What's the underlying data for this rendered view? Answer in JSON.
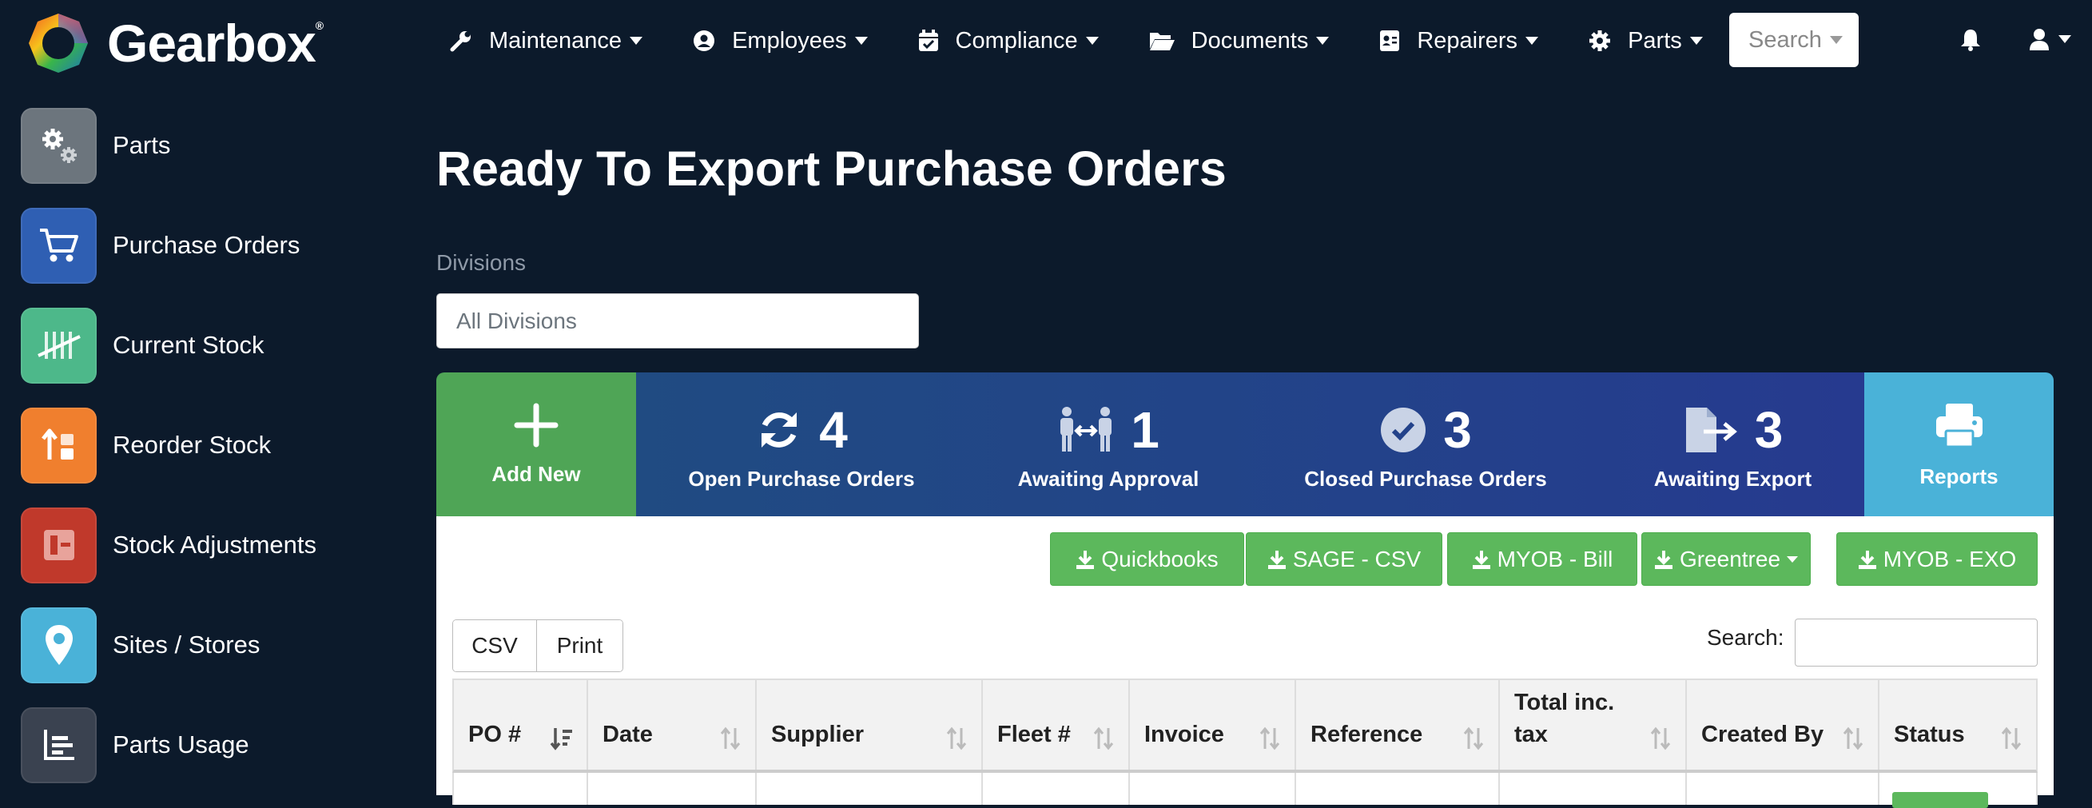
{
  "app": {
    "name": "Gearbox",
    "registered_mark": "®"
  },
  "nav": {
    "items": [
      {
        "label": "Maintenance",
        "icon": "wrench-icon"
      },
      {
        "label": "Employees",
        "icon": "user-circle-icon"
      },
      {
        "label": "Compliance",
        "icon": "calendar-check-icon"
      },
      {
        "label": "Documents",
        "icon": "folder-open-icon"
      },
      {
        "label": "Repairers",
        "icon": "id-card-icon"
      },
      {
        "label": "Parts",
        "icon": "gear-icon"
      }
    ],
    "search_label": "Search"
  },
  "sidebar": {
    "items": [
      {
        "label": "Parts",
        "icon": "gears-icon",
        "color": "#6c757d"
      },
      {
        "label": "Purchase Orders",
        "icon": "shopping-cart-icon",
        "color": "#2f5fb3"
      },
      {
        "label": "Current Stock",
        "icon": "tally-icon",
        "color": "#4db88a"
      },
      {
        "label": "Reorder Stock",
        "icon": "reorder-icon",
        "color": "#f07f2e"
      },
      {
        "label": "Stock Adjustments",
        "icon": "adjust-icon",
        "color": "#c0392b"
      },
      {
        "label": "Sites / Stores",
        "icon": "map-pin-icon",
        "color": "#4ab2d8"
      },
      {
        "label": "Parts Usage",
        "icon": "bar-chart-icon",
        "color": "#3a4250"
      }
    ]
  },
  "page": {
    "title": "Ready To Export Purchase Orders",
    "divisions_label": "Divisions",
    "divisions_placeholder": "All Divisions"
  },
  "stats": {
    "add_new": "Add New",
    "open": {
      "count": "4",
      "label": "Open Purchase Orders"
    },
    "awaiting_approval": {
      "count": "1",
      "label": "Awaiting Approval"
    },
    "closed": {
      "count": "3",
      "label": "Closed Purchase Orders"
    },
    "awaiting_export": {
      "count": "3",
      "label": "Awaiting Export"
    },
    "reports": "Reports"
  },
  "export_buttons": [
    "Quickbooks",
    "SAGE - CSV",
    "MYOB - Bill",
    "Greentree",
    "MYOB - EXO"
  ],
  "table_tools": {
    "csv": "CSV",
    "print": "Print",
    "search_label": "Search:"
  },
  "table": {
    "columns": [
      {
        "label": "PO #"
      },
      {
        "label": "Date"
      },
      {
        "label": "Supplier"
      },
      {
        "label": "Fleet #"
      },
      {
        "label": "Invoice"
      },
      {
        "label": "Reference"
      },
      {
        "label": "Total inc.\ntax"
      },
      {
        "label": "Created By"
      },
      {
        "label": "Status"
      }
    ]
  },
  "colors": {
    "background": "#0c1a2b",
    "add_new": "#4fa556",
    "stats_band": "#23428a",
    "reports": "#4ab2d8",
    "export_green": "#5cb85c"
  }
}
